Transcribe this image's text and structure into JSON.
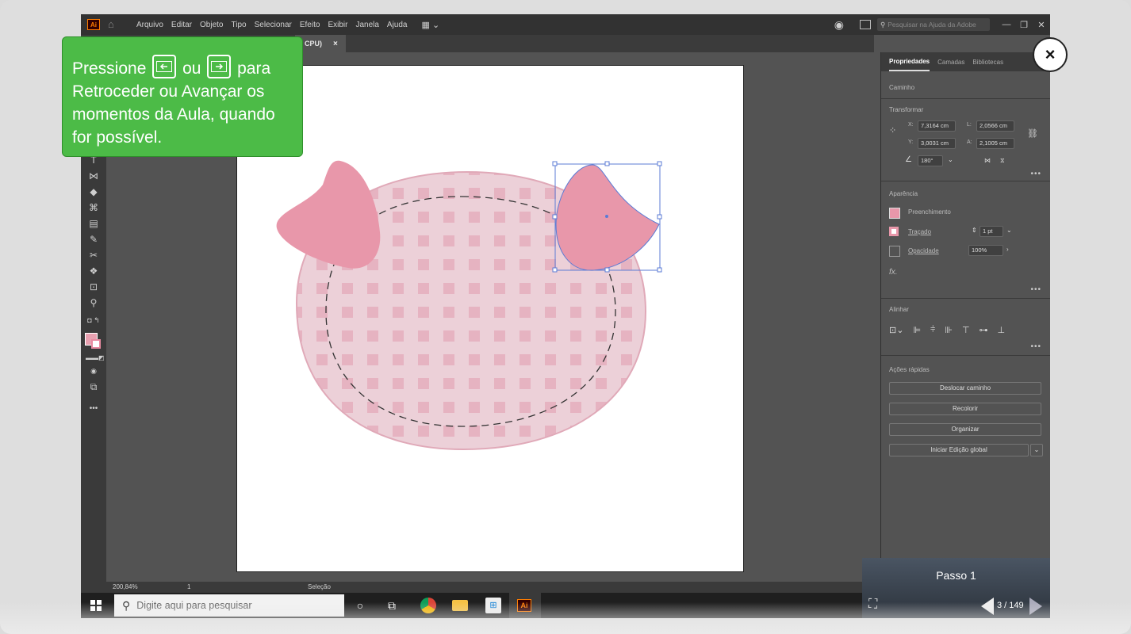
{
  "app": {
    "logo": "Ai",
    "menu": [
      "Arquivo",
      "Editar",
      "Objeto",
      "Tipo",
      "Selecionar",
      "Efeito",
      "Exibir",
      "Janela",
      "Ajuda"
    ],
    "help_search_placeholder": "Pesquisar na Ajuda da Adobe",
    "doc_tab": "CPU)",
    "doc_tab_close": "×"
  },
  "status": {
    "zoom": "200,84%",
    "page": "1",
    "tool": "Seleção"
  },
  "properties_panel": {
    "tabs": [
      "Propriedades",
      "Camadas",
      "Bibliotecas"
    ],
    "object_type": "Caminho",
    "transform": {
      "title": "Transformar",
      "x_label": "X:",
      "x": "7,3164 cm",
      "y_label": "Y:",
      "y": "3,0031 cm",
      "w_label": "L:",
      "w": "2,0566 cm",
      "h_label": "A:",
      "h": "2,1005 cm",
      "angle": "180°"
    },
    "appearance": {
      "title": "Aparência",
      "fill_label": "Preenchimento",
      "stroke_label": "Traçado",
      "stroke_weight": "1 pt",
      "opacity_label": "Opacidade",
      "opacity": "100%",
      "fx": "fx."
    },
    "align": {
      "title": "Alinhar"
    },
    "quick_actions": {
      "title": "Ações rápidas",
      "buttons": [
        "Deslocar caminho",
        "Recolorir",
        "Organizar",
        "Iniciar Edição global"
      ]
    },
    "more": "•••"
  },
  "taskbar": {
    "search_placeholder": "Digite aqui para pesquisar",
    "ai_label": "Ai"
  },
  "tooltip": {
    "word1": "Pressione",
    "word2": "ou",
    "rest": "para Retroceder ou Avançar os momentos da Aula, quando for possível."
  },
  "player": {
    "step_title": "Passo 1",
    "page_counter": "3 / 149",
    "close": "×"
  },
  "colors": {
    "pink_shape": "#e897aa",
    "face_fill": "#e9c4ce",
    "selection": "#5b7bd5",
    "tooltip_green": "#4cbb47"
  }
}
